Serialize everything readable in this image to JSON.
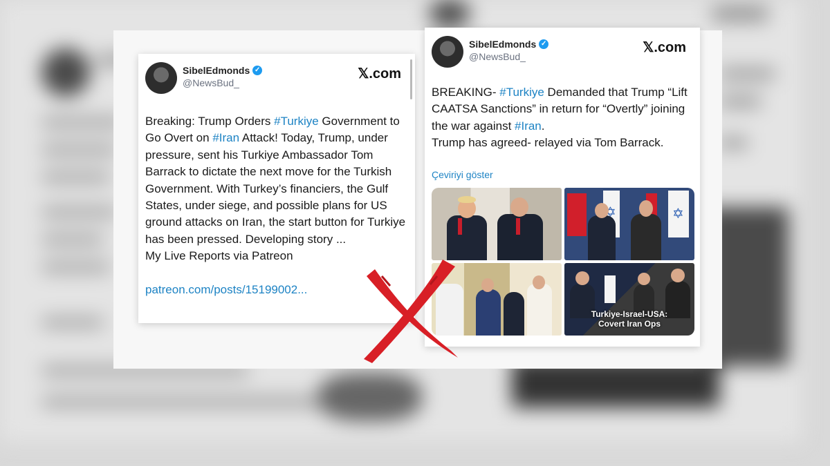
{
  "left_post": {
    "display_name": "SibelEdmonds",
    "handle": "@NewsBud_",
    "site": "𝕏.com",
    "text_parts": [
      {
        "t": "Breaking: Trump Orders ",
        "hash": false
      },
      {
        "t": "#Turkiye",
        "hash": true
      },
      {
        "t": " Government to Go Overt on ",
        "hash": false
      },
      {
        "t": "#Iran",
        "hash": true
      },
      {
        "t": " Attack! Today, Trump, under pressure, sent his Turkiye Ambassador Tom Barrack to dictate the next move for the Turkish Government. With Turkey’s financiers, the Gulf States, under siege, and possible plans for US ground attacks on Iran, the start button for Turkiye has been pressed. Developing story ...",
        "hash": false
      }
    ],
    "reports_line": "My Live Reports via Patreon",
    "link": "patreon.com/posts/15199002..."
  },
  "right_post": {
    "display_name": "SibelEdmonds",
    "handle": "@NewsBud_",
    "site": "𝕏.com",
    "text_parts": [
      {
        "t": "BREAKING- ",
        "hash": false
      },
      {
        "t": "#Turkiye",
        "hash": true
      },
      {
        "t": " Demanded that Trump “Lift CAATSA Sanctions” in return for “Overtly” joining the war against ",
        "hash": false
      },
      {
        "t": "#Iran",
        "hash": true
      },
      {
        "t": ".",
        "hash": false
      }
    ],
    "line2": "Trump has agreed- relayed  via Tom Barrack.",
    "translate": "Çeviriyi göster",
    "photo_caption": [
      "Turkiye-Israel-USA:",
      "Covert Iran Ops"
    ]
  },
  "icons": [
    "verified-badge-icon",
    "x-logo-icon",
    "false-claim-cross-icon"
  ],
  "colors": {
    "hashtag": "#1d83c4",
    "verified": "#1d9bf0",
    "cross": "#d81f26"
  }
}
